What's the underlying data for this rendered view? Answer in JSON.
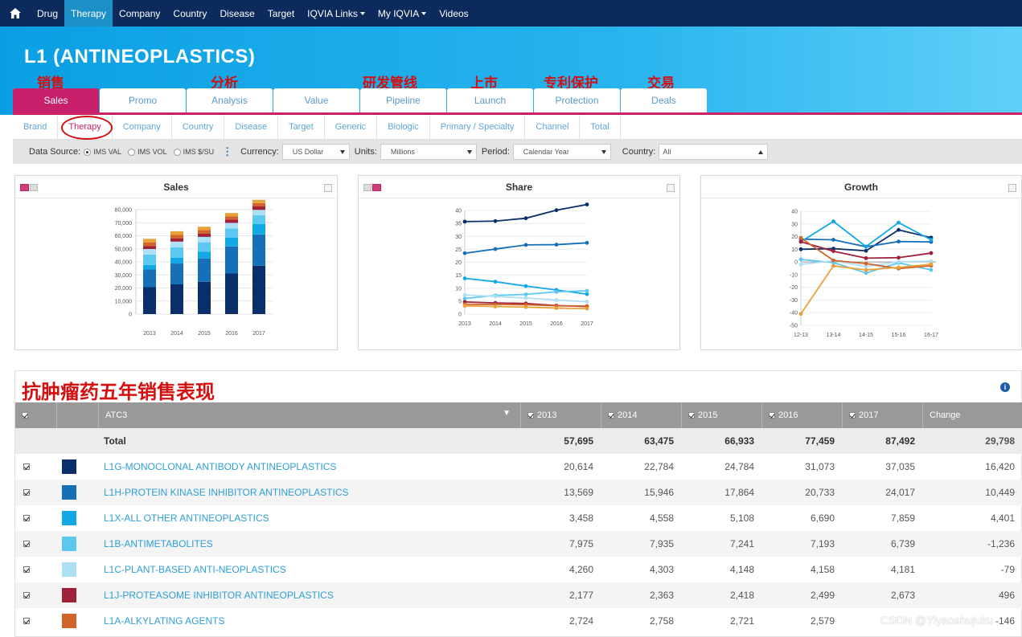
{
  "topnav": {
    "items": [
      {
        "label": "Drug"
      },
      {
        "label": "Therapy"
      },
      {
        "label": "Company"
      },
      {
        "label": "Country"
      },
      {
        "label": "Disease"
      },
      {
        "label": "Target"
      },
      {
        "label": "IQVIA Links"
      },
      {
        "label": "My IQVIA"
      },
      {
        "label": "Videos"
      }
    ],
    "active_index": 1
  },
  "page": {
    "title": "L1 (ANTINEOPLASTICS)"
  },
  "annotations": {
    "sales_cn": "销售",
    "analysis_cn": "分析",
    "pipeline_cn": "研发管线",
    "launch_cn": "上市",
    "protection_cn": "专利保护",
    "deals_cn": "交易",
    "table_title_cn": "抗肿瘤药五年销售表现"
  },
  "main_tabs": [
    {
      "label": "Sales"
    },
    {
      "label": "Promo"
    },
    {
      "label": "Analysis"
    },
    {
      "label": "Value"
    },
    {
      "label": "Pipeline"
    },
    {
      "label": "Launch"
    },
    {
      "label": "Protection"
    },
    {
      "label": "Deals"
    }
  ],
  "sub_tabs": [
    {
      "label": "Brand"
    },
    {
      "label": "Therapy"
    },
    {
      "label": "Company"
    },
    {
      "label": "Country"
    },
    {
      "label": "Disease"
    },
    {
      "label": "Target"
    },
    {
      "label": "Generic"
    },
    {
      "label": "Biologic"
    },
    {
      "label": "Primary / Specialty"
    },
    {
      "label": "Channel"
    },
    {
      "label": "Total"
    }
  ],
  "filters": {
    "data_source_label": "Data Source:",
    "radio_val": "IMS VAL",
    "radio_vol": "IMS VOL",
    "radio_su": "IMS $/SU",
    "currency_label": "Currency:",
    "currency_value": "US Dollar",
    "units_label": "Units:",
    "units_value": "Millions",
    "period_label": "Period:",
    "period_value": "Calendar Year",
    "country_label": "Country:",
    "country_value": "All"
  },
  "panels": {
    "sales_title": "Sales",
    "share_title": "Share",
    "growth_title": "Growth"
  },
  "series_colors": {
    "L1G": "#0b2f6b",
    "L1H": "#1570b8",
    "L1X": "#12a8e6",
    "L1B": "#5cc8f0",
    "L1C": "#aee0f5",
    "L1J": "#a0203a",
    "L1A": "#d0642a",
    "other": "#e9a23b"
  },
  "chart_data": [
    {
      "type": "bar",
      "stacked": true,
      "categories": [
        "2013",
        "2014",
        "2015",
        "2016",
        "2017"
      ],
      "ylim": [
        0,
        80000
      ],
      "yticks": [
        "0",
        "10,000",
        "20,000",
        "30,000",
        "40,000",
        "50,000",
        "60,000",
        "70,000",
        "80,000"
      ],
      "series": [
        {
          "name": "L1G-MONOCLONAL ANTIBODY ANTINEOPLASTICS",
          "values": [
            20614,
            22784,
            24784,
            31073,
            37035
          ]
        },
        {
          "name": "L1H-PROTEIN KINASE INHIBITOR ANTINEOPLASTICS",
          "values": [
            13569,
            15946,
            17864,
            20733,
            24017
          ]
        },
        {
          "name": "L1X-ALL OTHER ANTINEOPLASTICS",
          "values": [
            3458,
            4558,
            5108,
            6690,
            7859
          ]
        },
        {
          "name": "L1B-ANTIMETABOLITES",
          "values": [
            7975,
            7935,
            7241,
            7193,
            6739
          ]
        },
        {
          "name": "L1C-PLANT-BASED ANTI-NEOPLASTICS",
          "values": [
            4260,
            4303,
            4148,
            4158,
            4181
          ]
        },
        {
          "name": "L1J-PROTEASOME INHIBITOR ANTINEOPLASTICS",
          "values": [
            2177,
            2363,
            2418,
            2499,
            2673
          ]
        },
        {
          "name": "L1A-ALKYLATING AGENTS",
          "values": [
            2724,
            2758,
            2721,
            2579,
            2500
          ]
        },
        {
          "values": [
            2918,
            2828,
            2649,
            2534,
            2488
          ]
        }
      ]
    },
    {
      "type": "line",
      "x": [
        "2013",
        "2014",
        "2015",
        "2016",
        "2017"
      ],
      "ylim": [
        0,
        40
      ],
      "yticks": [
        "0",
        "5",
        "10",
        "15",
        "20",
        "25",
        "30",
        "35",
        "40"
      ],
      "series": [
        {
          "values": [
            35.7,
            35.9,
            37.0,
            40.1,
            42.3
          ]
        },
        {
          "values": [
            23.5,
            25.1,
            26.7,
            26.8,
            27.5
          ]
        },
        {
          "values": [
            13.8,
            12.5,
            10.8,
            9.3,
            7.7
          ]
        },
        {
          "values": [
            6.0,
            7.2,
            7.6,
            8.6,
            9.0
          ]
        },
        {
          "values": [
            7.4,
            6.8,
            6.2,
            5.4,
            4.8
          ]
        },
        {
          "values": [
            4.7,
            4.3,
            4.1,
            3.3,
            2.9
          ]
        },
        {
          "values": [
            3.8,
            3.7,
            3.6,
            3.2,
            3.1
          ]
        },
        {
          "values": [
            3.2,
            2.9,
            2.7,
            2.3,
            2.1
          ]
        }
      ]
    },
    {
      "type": "line",
      "x": [
        "12-13",
        "13-14",
        "14-15",
        "15-16",
        "16-17"
      ],
      "ylim": [
        -50,
        40
      ],
      "yticks": [
        "-50",
        "-40",
        "-30",
        "-20",
        "-10",
        "0",
        "10",
        "20",
        "30",
        "40"
      ],
      "series": [
        {
          "values": [
            10,
            10.5,
            8.8,
            25.3,
            19.2
          ]
        },
        {
          "values": [
            18,
            17.5,
            12.0,
            16.1,
            15.8
          ]
        },
        {
          "values": [
            16,
            32.0,
            12.1,
            31.0,
            17.5
          ]
        },
        {
          "values": [
            2,
            -0.5,
            -8.7,
            -0.7,
            -6.3
          ]
        },
        {
          "values": [
            -2,
            1.0,
            -3.6,
            0.2,
            0.6
          ]
        },
        {
          "values": [
            16,
            8.5,
            3.0,
            3.4,
            7.0
          ]
        },
        {
          "values": [
            19,
            1.2,
            -1.3,
            -5.2,
            -3.0
          ]
        },
        {
          "values": [
            -41,
            -3.1,
            -6.3,
            -4.3,
            -1.8
          ]
        }
      ]
    }
  ],
  "table": {
    "col_atc3": "ATC3",
    "col_2013": "2013",
    "col_2014": "2014",
    "col_2015": "2015",
    "col_2016": "2016",
    "col_2017": "2017",
    "col_change": "Change",
    "total": {
      "name": "Total",
      "v2013": "57,695",
      "v2014": "63,475",
      "v2015": "66,933",
      "v2016": "77,459",
      "v2017": "87,492",
      "change": "29,798"
    },
    "rows": [
      {
        "name": "L1G-MONOCLONAL ANTIBODY ANTINEOPLASTICS",
        "color": "#0b2f6b",
        "v2013": "20,614",
        "v2014": "22,784",
        "v2015": "24,784",
        "v2016": "31,073",
        "v2017": "37,035",
        "change": "16,420"
      },
      {
        "name": "L1H-PROTEIN KINASE INHIBITOR ANTINEOPLASTICS",
        "color": "#1570b8",
        "v2013": "13,569",
        "v2014": "15,946",
        "v2015": "17,864",
        "v2016": "20,733",
        "v2017": "24,017",
        "change": "10,449"
      },
      {
        "name": "L1X-ALL OTHER ANTINEOPLASTICS",
        "color": "#12a8e6",
        "v2013": "3,458",
        "v2014": "4,558",
        "v2015": "5,108",
        "v2016": "6,690",
        "v2017": "7,859",
        "change": "4,401"
      },
      {
        "name": "L1B-ANTIMETABOLITES",
        "color": "#5cc8f0",
        "v2013": "7,975",
        "v2014": "7,935",
        "v2015": "7,241",
        "v2016": "7,193",
        "v2017": "6,739",
        "change": "-1,236"
      },
      {
        "name": "L1C-PLANT-BASED ANTI-NEOPLASTICS",
        "color": "#aee0f5",
        "v2013": "4,260",
        "v2014": "4,303",
        "v2015": "4,148",
        "v2016": "4,158",
        "v2017": "4,181",
        "change": "-79"
      },
      {
        "name": "L1J-PROTEASOME INHIBITOR ANTINEOPLASTICS",
        "color": "#a0203a",
        "v2013": "2,177",
        "v2014": "2,363",
        "v2015": "2,418",
        "v2016": "2,499",
        "v2017": "2,673",
        "change": "496"
      },
      {
        "name": "L1A-ALKYLATING AGENTS",
        "color": "#d0642a",
        "v2013": "2,724",
        "v2014": "2,758",
        "v2015": "2,721",
        "v2016": "2,579",
        "v2017": "",
        "change": "-146"
      }
    ]
  },
  "watermark": "CSDN @Yiyaoshujuku"
}
